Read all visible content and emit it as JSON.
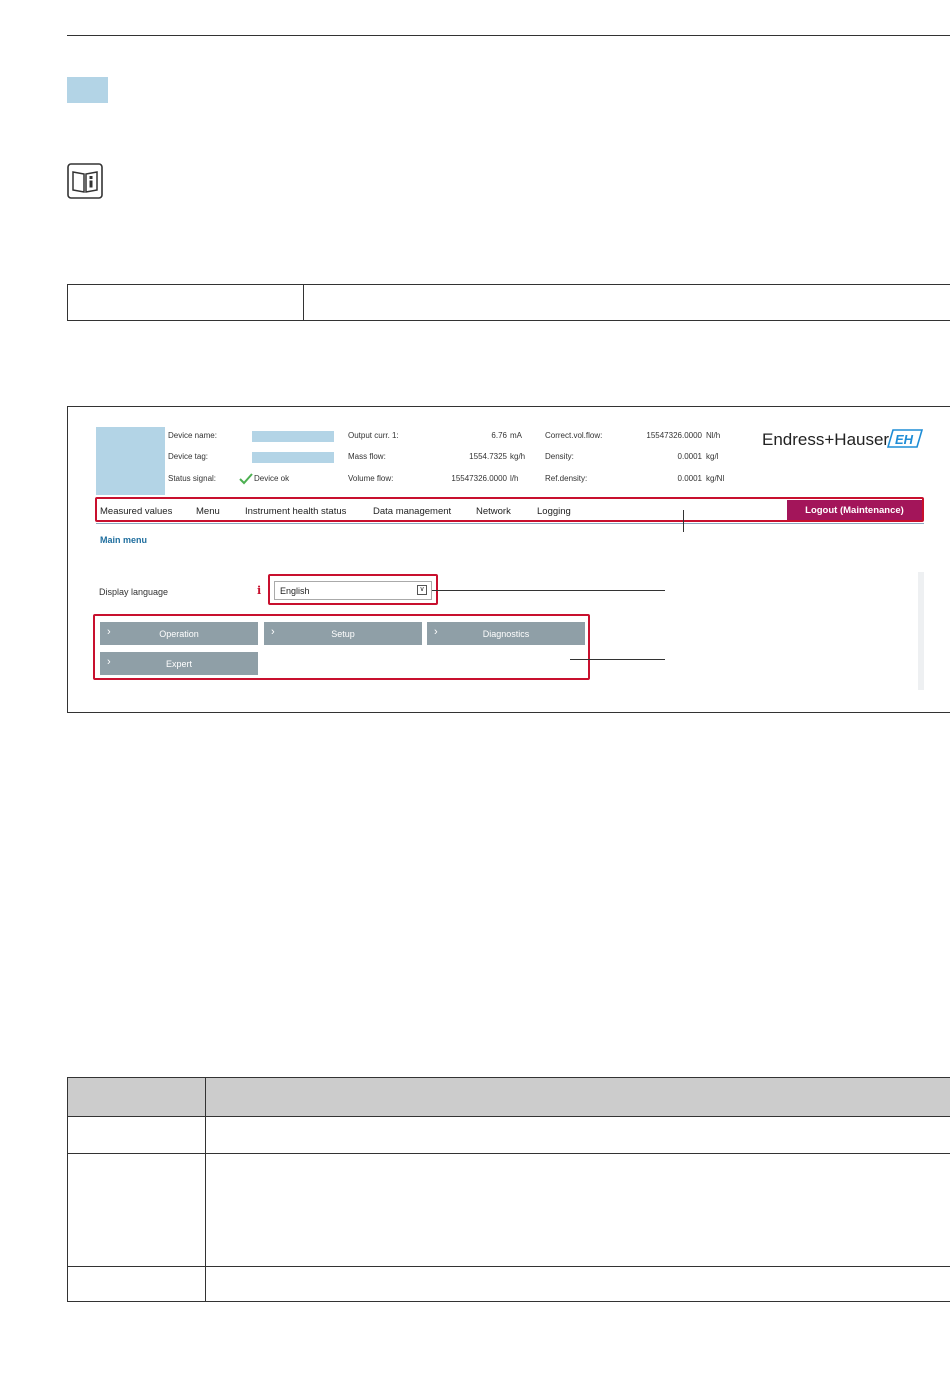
{
  "device_header": {
    "device_name_label": "Device name:",
    "device_tag_label": "Device tag:",
    "status_signal_label": "Status signal:",
    "status_value": "Device ok",
    "output_curr_label": "Output curr. 1:",
    "output_curr_value": "6.76",
    "output_curr_unit": "mA",
    "mass_flow_label": "Mass flow:",
    "mass_flow_value": "1554.7325",
    "mass_flow_unit": "kg/h",
    "volume_flow_label": "Volume flow:",
    "volume_flow_value": "15547326.0000",
    "volume_flow_unit": "l/h",
    "correct_vol_flow_label": "Correct.vol.flow:",
    "correct_vol_flow_value": "15547326.0000",
    "correct_vol_flow_unit": "Nl/h",
    "density_label": "Density:",
    "density_value": "0.0001",
    "density_unit": "kg/l",
    "ref_density_label": "Ref.density:",
    "ref_density_value": "0.0001",
    "ref_density_unit": "kg/Nl"
  },
  "brand": {
    "name": "Endress+Hauser",
    "logo_text": "EH",
    "logo_color": "#1f8dd6"
  },
  "nav": {
    "items": [
      "Measured values",
      "Menu",
      "Instrument health status",
      "Data management",
      "Network",
      "Logging"
    ],
    "logout_label": "Logout (Maintenance)"
  },
  "main": {
    "title": "Main menu",
    "display_language_label": "Display language",
    "language_value": "English",
    "buttons": [
      "Operation",
      "Setup",
      "Diagnostics",
      "Expert"
    ]
  },
  "colors": {
    "highlight": "#c8102e",
    "logout_bg": "#a3155a",
    "button_bg": "#8f9fa7",
    "placeholder_blue": "#b3d4e6"
  }
}
